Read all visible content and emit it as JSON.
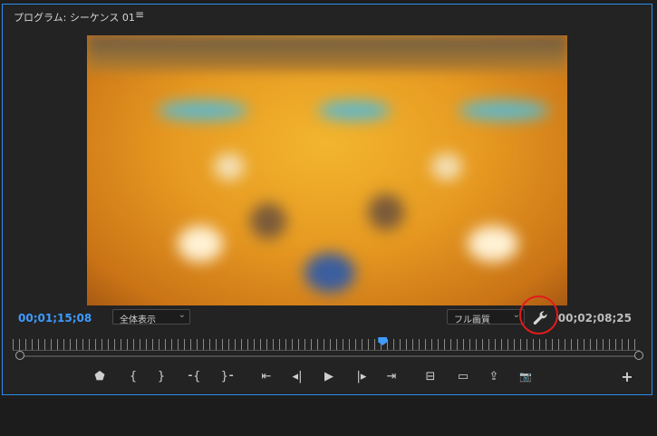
{
  "panel": {
    "title": "プログラム: シーケンス 01",
    "menu_glyph": "≡"
  },
  "timecode": {
    "current": "00;01;15;08",
    "duration": "00;02;08;25"
  },
  "zoom_dropdown": {
    "selected": "全体表示"
  },
  "quality_dropdown": {
    "selected": "フル画質"
  },
  "playhead_position": 0.59,
  "colors": {
    "accent": "#3e9bff",
    "highlight": "#e21b1b",
    "panel_border": "#2d8ceb"
  },
  "transport": {
    "buttons": [
      {
        "name": "add-marker",
        "glyph": "⬟"
      },
      {
        "name": "mark-in",
        "glyph": "{"
      },
      {
        "name": "mark-out",
        "glyph": "}"
      },
      {
        "name": "go-to-in",
        "glyph": "⁃{"
      },
      {
        "name": "go-to-out",
        "glyph": "}⁃"
      },
      {
        "name": "go-to-previous-edit",
        "glyph": "⇤"
      },
      {
        "name": "step-back",
        "glyph": "◂|"
      },
      {
        "name": "play",
        "glyph": "▶"
      },
      {
        "name": "step-forward",
        "glyph": "|▸"
      },
      {
        "name": "go-to-next-edit",
        "glyph": "⇥"
      },
      {
        "name": "lift",
        "glyph": "⊟"
      },
      {
        "name": "extract",
        "glyph": "▭"
      },
      {
        "name": "export-frame-share",
        "glyph": "⇪"
      },
      {
        "name": "camera",
        "glyph": "📷"
      },
      {
        "name": "button-editor-add",
        "glyph": "+"
      }
    ]
  }
}
